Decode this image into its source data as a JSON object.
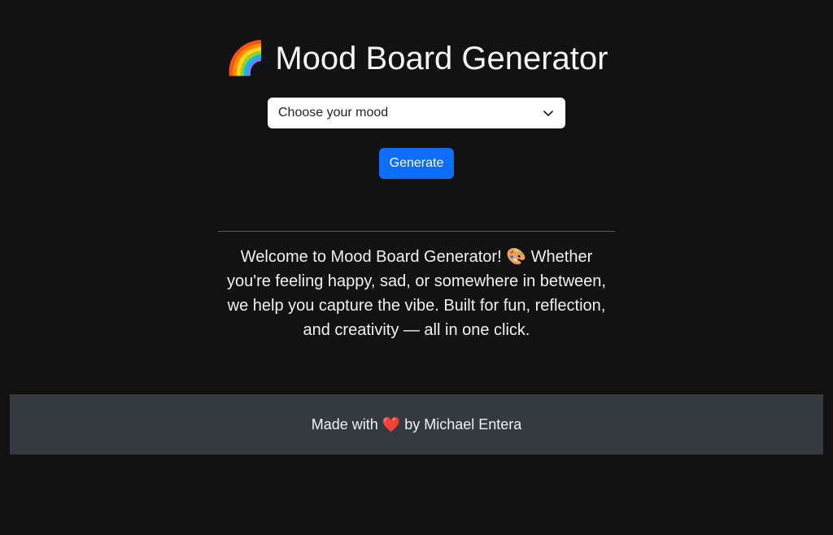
{
  "header": {
    "emoji": "🌈",
    "title": "Mood Board Generator"
  },
  "mood_select": {
    "selected": "Choose your mood",
    "icon": "chevron-down-icon"
  },
  "generate_button": {
    "label": "Generate",
    "color": "#0d6efd"
  },
  "welcome": {
    "text": "Welcome to Mood Board Generator! 🎨 Whether you're feeling happy, sad, or somewhere in between, we help you capture the vibe. Built for fun, reflection, and creativity — all in one click."
  },
  "footer": {
    "prefix": "Made with",
    "heart": "❤️",
    "suffix": "by Michael Entera",
    "background": "#343a40"
  },
  "colors": {
    "page_background": "#121212",
    "accent": "#0d6efd",
    "heart": "#e0245e"
  }
}
